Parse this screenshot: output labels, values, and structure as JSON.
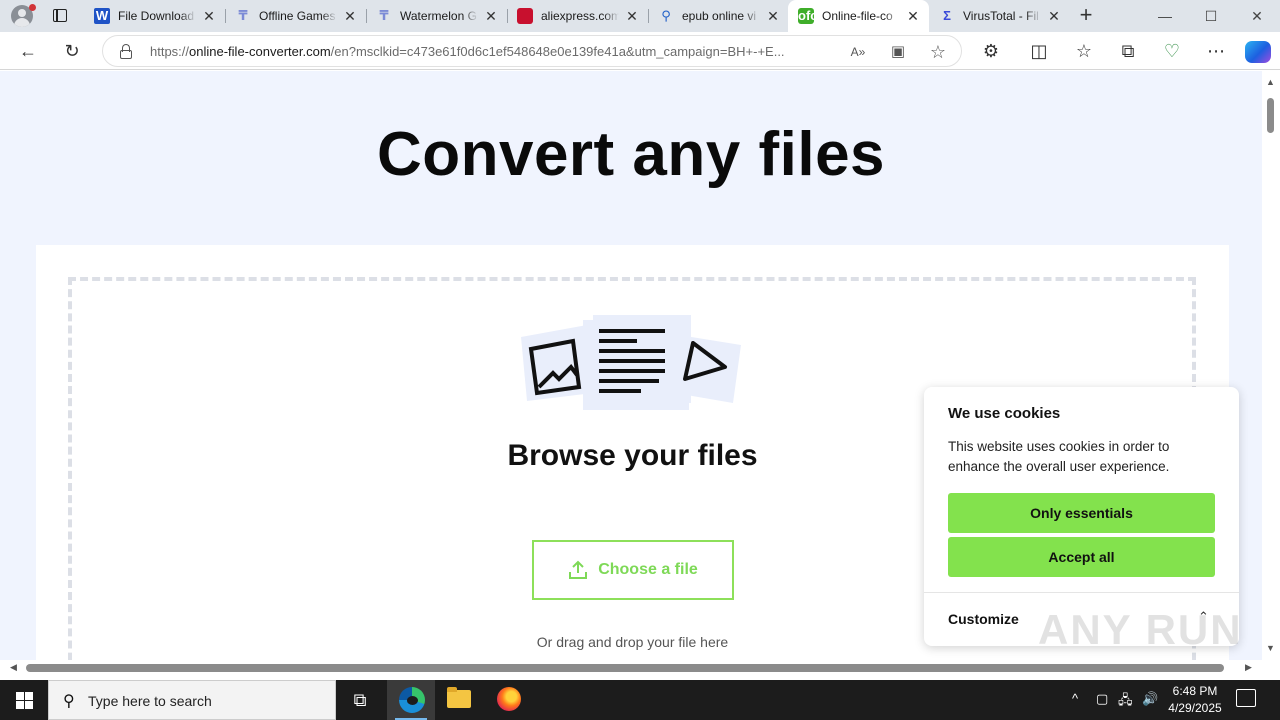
{
  "browser": {
    "tabs": [
      {
        "title": "File Download",
        "favicon": "word-doc-icon",
        "active": false
      },
      {
        "title": "Offline Games",
        "favicon": "template-icon",
        "active": false
      },
      {
        "title": "Watermelon G",
        "favicon": "template-icon",
        "active": false
      },
      {
        "title": "aliexpress.com",
        "favicon": "aliexpress-icon",
        "active": false
      },
      {
        "title": "epub online vi",
        "favicon": "search-icon",
        "active": false
      },
      {
        "title": "Online-file-co",
        "favicon": "online-file-converter-icon",
        "active": true
      },
      {
        "title": "VirusTotal - Fil",
        "favicon": "virustotal-icon",
        "active": false
      }
    ],
    "favicon_glyphs": {
      "word": "W",
      "tpl": "₸",
      "ali": "🛒",
      "search": "🔍",
      "ofc": "ofc",
      "vt": "Σ"
    },
    "address_bar": {
      "scheme": "https://",
      "host": "online-file-converter.com",
      "path": "/en?msclkid=c473e61f0d6c1ef548648e0e139fe41a&utm_campaign=BH+-+E..."
    },
    "glyphs": {
      "back": "←",
      "refresh": "↻",
      "read_aloud": "A»",
      "immersive": "▣",
      "favorite_star": "☆",
      "extensions": "⚙",
      "split": "◫",
      "favorites": "☆",
      "collections": "⧉",
      "performance": "♡",
      "more": "⋯",
      "tab_close": "✕",
      "new_tab": "+",
      "minimize": "—",
      "maximize": "☐",
      "window_close": "✕"
    }
  },
  "page": {
    "hero_title": "Convert any files",
    "browse_title": "Browse your files",
    "choose_button": "Choose a file",
    "drag_text": "Or drag and drop your file here"
  },
  "cookie_banner": {
    "title": "We use cookies",
    "text": "This website uses cookies in order to enhance the overall user experience.",
    "only_essentials": "Only essentials",
    "accept_all": "Accept all",
    "customize": "Customize",
    "chevron": "⌃"
  },
  "watermark": "ANY RUN",
  "taskbar": {
    "search_placeholder": "Type here to search",
    "time": "6:48 PM",
    "date": "4/29/2025",
    "glyphs": {
      "search": "⚲",
      "task_view": "⧉",
      "tray_chevron": "^",
      "tray_device": "▢",
      "tray_network": "🖧",
      "tray_volume": "🔊"
    }
  },
  "colors": {
    "accent_green": "#83e24d",
    "page_background": "#f0f4fe",
    "tabstrip": "#dfe4ea"
  }
}
